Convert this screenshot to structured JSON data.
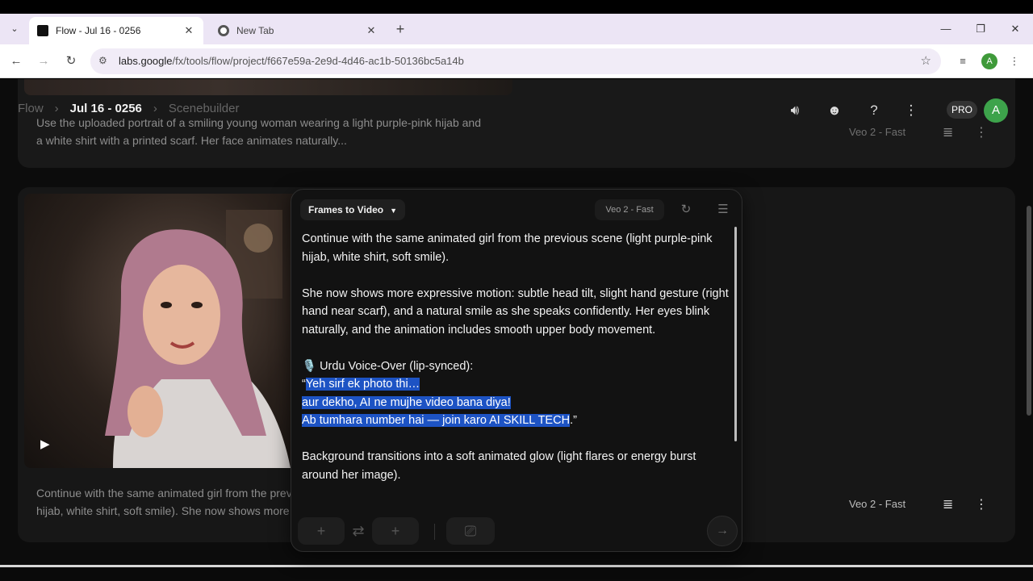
{
  "browser": {
    "tabs": [
      {
        "title": "Flow - Jul 16 - 0256",
        "active": true,
        "favicon": "flow-icon"
      },
      {
        "title": "New Tab",
        "active": false,
        "favicon": "chrome-icon"
      }
    ],
    "url_host": "labs.google",
    "url_path": "/fx/tools/flow/project/f667e59a-2e9d-4d46-ac1b-50136bc5a14b",
    "profile_initial": "A"
  },
  "header": {
    "breadcrumb": [
      "Flow",
      "Jul 16 - 0256",
      "Scenebuilder"
    ],
    "pro_label": "PRO",
    "avatar_initial": "A",
    "icons": [
      "volume-icon",
      "discord-icon",
      "help-icon",
      "more-vert-icon"
    ]
  },
  "cards": [
    {
      "prompt_preview": "Use the uploaded portrait of a smiling young woman wearing a light purple-pink hijab and a white shirt with a printed scarf. Her face animates naturally...",
      "model": "Veo 2 - Fast"
    },
    {
      "prompt_preview": "Continue with the same animated girl from the previous scene (light purple-pink hijab, white shirt, soft smile). She now shows more expressive motion...",
      "model": "Veo 2 - Fast"
    }
  ],
  "editor": {
    "mode": "Frames to Video",
    "model": "Veo 2 - Fast",
    "paragraph1": "Continue with the same animated girl from the previous scene (light purple-pink hijab, white shirt, soft smile).",
    "paragraph2": "She now shows more expressive motion: subtle head tilt, slight hand gesture (right hand near scarf), and a natural smile as she speaks confidently. Her eyes blink naturally, and the animation includes smooth upper body movement.",
    "voice_heading": "🎙️ Urdu Voice-Over (lip-synced):",
    "open_quote": "“",
    "voice_line1": "Yeh sirf ek photo thi…",
    "voice_line2": "aur dekho, AI ne mujhe video bana diya!",
    "voice_line3": "Ab tumhara number hai — join karo AI SKILL TECH",
    "close_quote": ".”",
    "paragraph4": "Background transitions into a soft animated glow (light flares or energy burst around her image).",
    "highlight_color": "#1d53c4"
  }
}
